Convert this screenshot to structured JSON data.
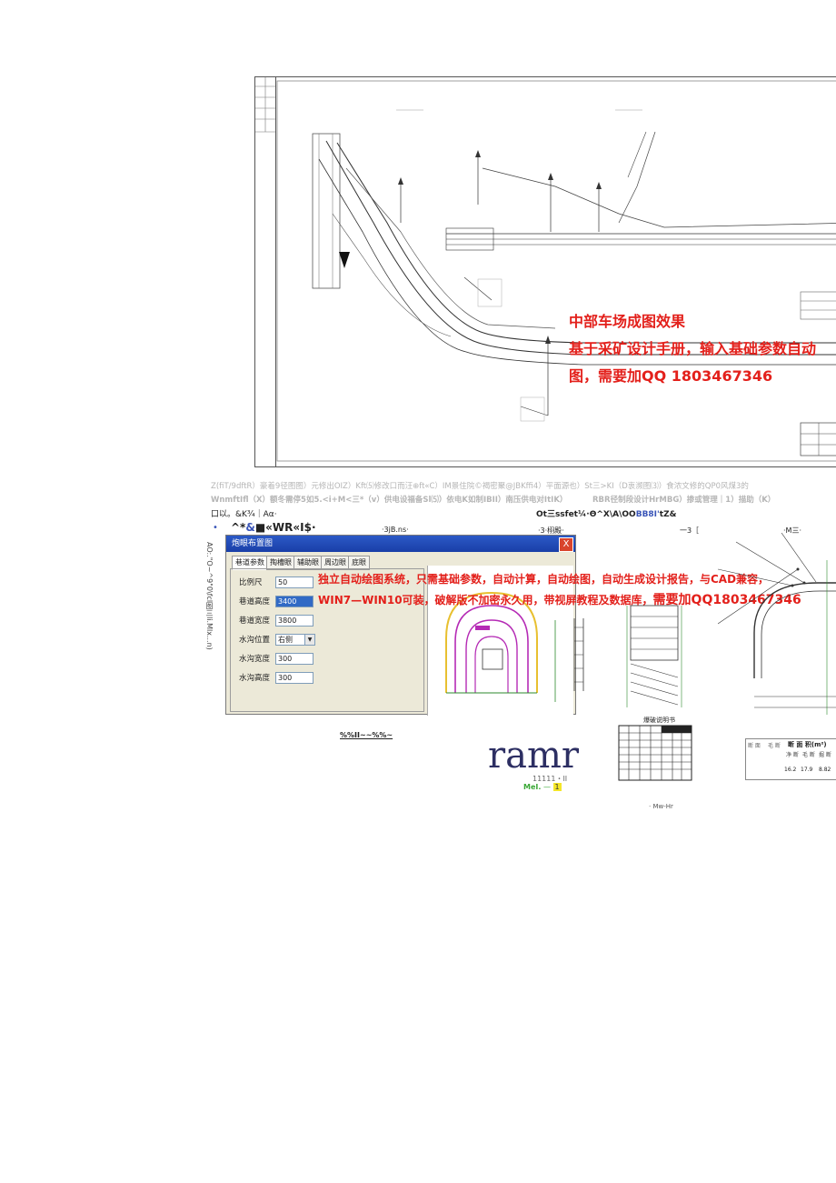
{
  "drawing": {
    "overlay_title": "中部车场成图效果",
    "overlay_line2": "基于采矿设计手册，输入基础参数自动",
    "overlay_line3": "图，需要加QQ 1803467346"
  },
  "captions": {
    "line1": "Z(fiT/9dftR）豪着9径图图）元修出OIZ）Kft⑸修改口而汪⊕ft«C）IM景住院©褐密聚@JBKffi4）平面源也）St三>KI（D衷濒图⑶）食浓文修的QP0风煤3的",
    "line2": "WnmftIfl（X）额冬需停5如5.<i+M<三*（v）供电设福备Sl⑸）依电K如制IBII）南压供电对ItIK）",
    "line2b": "RBR径制段设计HrMBG）掺或管理｜1）描助（K）",
    "line3": "口以。&K¾｜Aα·",
    "line3b_a": "Ot三ssfet¼·Θ^X\\A\\OO",
    "line3b_b": "BB8I'",
    "line3b_c": "tZ&"
  },
  "row_labels": {
    "bullet": "•",
    "a": "^*",
    "a_blue": "&",
    "a_rest": "■«WR«I$·",
    "b": "·3jB.ns·",
    "c": "·3·栩殿·",
    "d": "一3［",
    "e": "·M三·"
  },
  "side_vertical": "AO:.\"O~^9\"0\\fcl图三li.Mlx...n)",
  "dialog": {
    "title": "炮眼布置图",
    "close": "X",
    "tabs": [
      "巷道参数",
      "掏槽眼",
      "辅助眼",
      "周边眼",
      "底眼"
    ],
    "fields": [
      {
        "label": "比例尺",
        "value": "50"
      },
      {
        "label": "巷道高度",
        "value": "3400"
      },
      {
        "label": "巷道宽度",
        "value": "3800"
      },
      {
        "label": "水沟位置",
        "value": "右侧"
      },
      {
        "label": "水沟宽度",
        "value": "300"
      },
      {
        "label": "水沟高度",
        "value": "300"
      }
    ]
  },
  "overlay2": {
    "line1": "独立自动绘图系统，只需基础参数，自动计算，自动绘图，自动生成设计报告，与CAD兼容，",
    "line2_a": "WIN7—WIN10可装，破解版不加密永久用，带视屏教程及数据库，",
    "line2_b": "需要加QQ1803467346"
  },
  "lower": {
    "underline_label": "%%II~~%%~",
    "big_word": "ramr",
    "small1": "11111・II",
    "green_label": "MeI.",
    "green_dash": "—",
    "yellow_mark": "1",
    "table_title": "爆破说明书",
    "mw_label": "· Mw-Hr",
    "right_table_title": "断 面 积(m²)",
    "right_table_left": "断 面",
    "right_table_mid": "毛 断",
    "right_table_cells": [
      "净 断",
      "毛 断",
      "掘 断",
      "16.2",
      "17.9",
      "8.82"
    ]
  },
  "colors": {
    "red": "#e3201b",
    "navy": "#2d2f63",
    "blue_accent": "#3a55b8",
    "green": "#3aa836",
    "yellow": "#f4e628"
  }
}
